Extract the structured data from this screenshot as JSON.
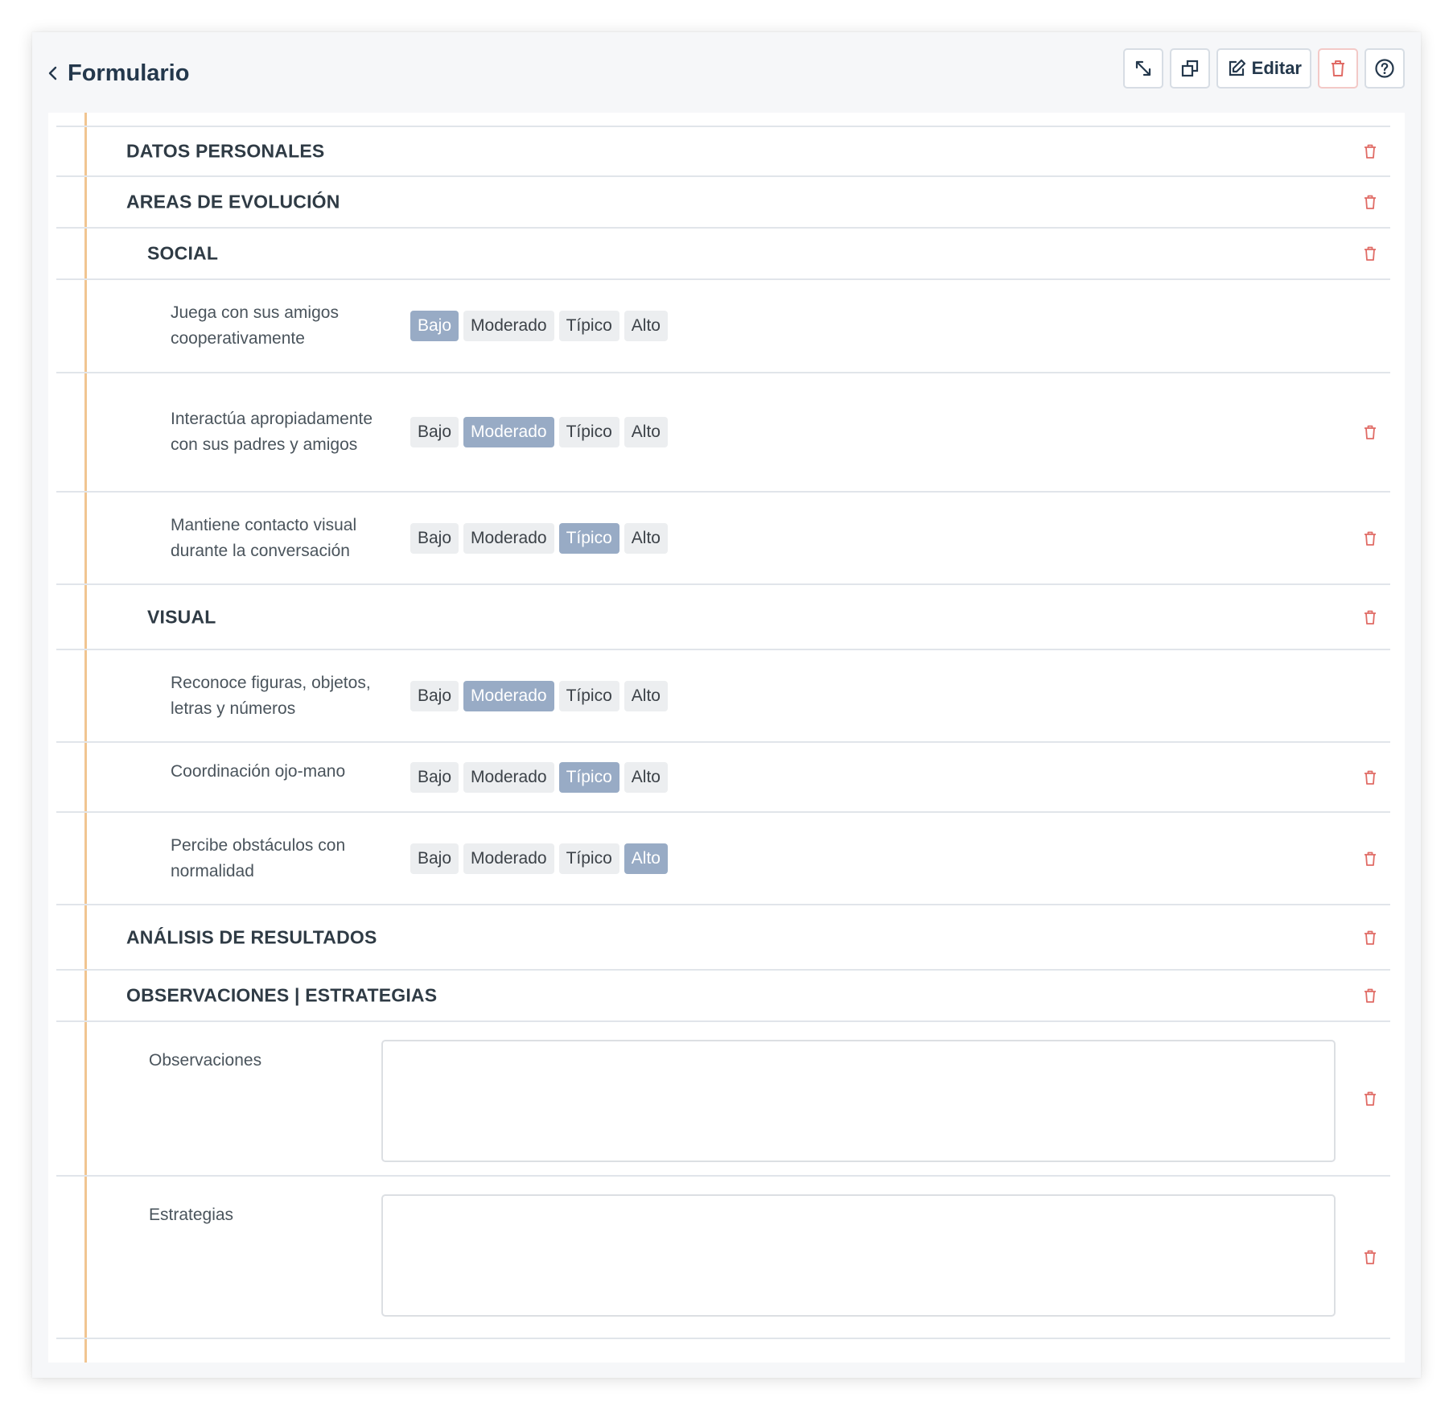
{
  "header": {
    "title": "Formulario",
    "edit_label": "Editar"
  },
  "option_labels": [
    "Bajo",
    "Moderado",
    "Típico",
    "Alto"
  ],
  "sections": {
    "datos_personales": "DATOS PERSONALES",
    "areas_evolucion": "AREAS DE EVOLUCIÓN",
    "social": "SOCIAL",
    "visual": "VISUAL",
    "analisis": "ANÁLISIS DE RESULTADOS",
    "observaciones_estrategias": "OBSERVACIONES | ESTRATEGIAS"
  },
  "questions": {
    "q1": {
      "label": "Juega con sus amigos cooperativamente",
      "selected": "Bajo"
    },
    "q2": {
      "label": "Interactúa apropiadamente con sus padres y amigos",
      "selected": "Moderado"
    },
    "q3": {
      "label": "Mantiene contacto visual durante la conversación",
      "selected": "Típico"
    },
    "q4": {
      "label": "Reconoce figuras, objetos, letras y números",
      "selected": "Moderado"
    },
    "q5": {
      "label": "Coordinación ojo-mano",
      "selected": "Típico"
    },
    "q6": {
      "label": "Percibe obstáculos con normalidad",
      "selected": "Alto"
    }
  },
  "fields": {
    "observaciones": {
      "label": "Observaciones",
      "value": ""
    },
    "estrategias": {
      "label": "Estrategias",
      "value": ""
    }
  },
  "colors": {
    "accent_line": "#f1c591",
    "selected_option": "#98abc5",
    "danger": "#e06b65",
    "title": "#24384c"
  },
  "icons": {
    "back": "chevron-left-icon",
    "expand": "expand-arrows-icon",
    "duplicate": "copy-icon",
    "edit": "edit-icon",
    "delete": "trash-icon",
    "help": "question-circle-icon"
  }
}
